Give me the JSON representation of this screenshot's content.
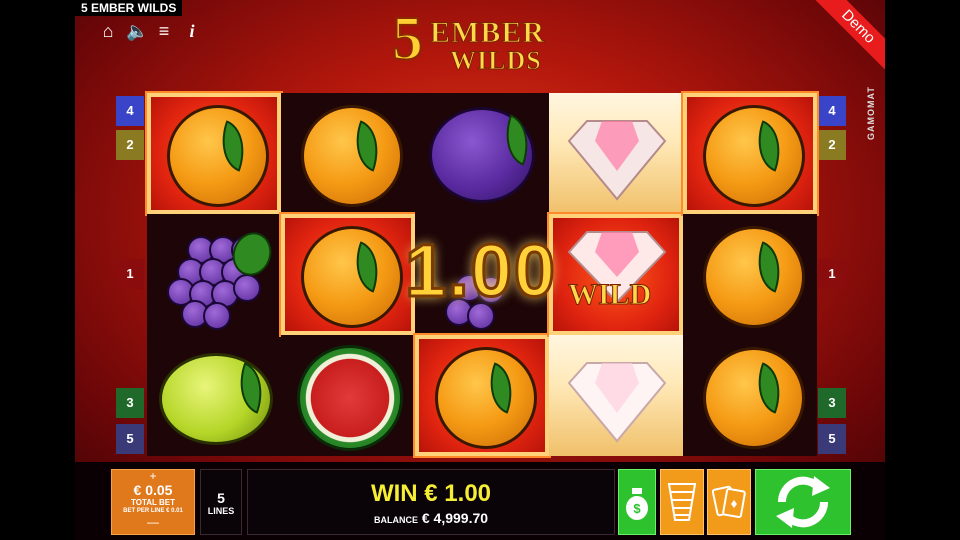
{
  "window_title": "5 EMBER WILDS",
  "logo": {
    "five": "5",
    "line1": "EMBER",
    "line2": "WILDS"
  },
  "demo_badge": "Demo",
  "provider": "GAMOMAT",
  "top_icons": [
    "home-icon",
    "speaker-icon",
    "menu-icon",
    "info-icon"
  ],
  "top_icon_glyphs": {
    "home": "⌂",
    "speaker": "🔈",
    "menu": "≡",
    "info": "i"
  },
  "left_lines": [
    "4",
    "2",
    "1",
    "3",
    "5"
  ],
  "right_lines": [
    "4",
    "2",
    "1",
    "3",
    "5"
  ],
  "reels": [
    [
      "orange",
      "grapes",
      "lemon"
    ],
    [
      "orange",
      "orange",
      "watermelon"
    ],
    [
      "plum",
      "grapes",
      "orange"
    ],
    [
      "diamond",
      "wild",
      "diamond"
    ],
    [
      "orange",
      "orange",
      "orange"
    ]
  ],
  "overlay_win": "1.00",
  "wild_label": "WILD",
  "bottom": {
    "bet_plus": "+",
    "bet_amount": "€ 0.05",
    "bet_label": "TOTAL BET",
    "bet_per_line": "BET PER LINE € 0.01",
    "bet_minus": "—",
    "lines_count": "5",
    "lines_label": "LINES",
    "win_text": "WIN € 1.00",
    "balance_label": "BALANCE",
    "balance_value": "€ 4,999.70"
  },
  "colors": {
    "accent_orange": "#f29a1a",
    "accent_green": "#2ec22e",
    "win_yellow": "#f5ee34"
  }
}
